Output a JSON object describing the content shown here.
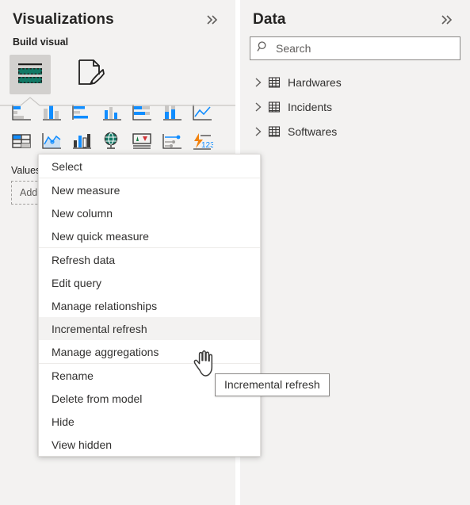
{
  "panes": {
    "visualizations": {
      "title": "Visualizations",
      "collapse_icon": "chevron-double-right-icon",
      "build_visual_label": "Build visual",
      "tabs": [
        {
          "name": "build-visual-tab",
          "icon": "fields-table-icon",
          "selected": true
        },
        {
          "name": "format-visual-tab",
          "icon": "paintbrush-page-icon",
          "selected": false
        }
      ],
      "gallery": [
        {
          "name": "stacked-bar-chart",
          "icon": "stacked-bar-chart-icon"
        },
        {
          "name": "stacked-column-chart",
          "icon": "stacked-column-chart-icon"
        },
        {
          "name": "clustered-bar-chart",
          "icon": "clustered-bar-chart-icon"
        },
        {
          "name": "clustered-column-chart",
          "icon": "clustered-column-chart-icon"
        },
        {
          "name": "hundred-percent-stacked-bar-chart",
          "icon": "pct-stacked-bar-icon"
        },
        {
          "name": "hundred-percent-stacked-column-chart",
          "icon": "pct-stacked-column-icon"
        },
        {
          "name": "line-chart",
          "icon": "line-chart-icon"
        },
        {
          "name": "table",
          "icon": "table-icon"
        },
        {
          "name": "line-and-stacked-column-chart",
          "icon": "line-stacked-column-icon"
        },
        {
          "name": "ribbon-chart",
          "icon": "ribbon-chart-icon"
        },
        {
          "name": "map",
          "icon": "globe-map-icon"
        },
        {
          "name": "kpi",
          "icon": "kpi-icon"
        },
        {
          "name": "decomposition-tree",
          "icon": "decomposition-tree-icon"
        },
        {
          "name": "key-influencers",
          "icon": "key-influencers-icon"
        }
      ],
      "wells": {
        "values_label": "Values",
        "drop_placeholder": "Add data fields here"
      }
    },
    "data": {
      "title": "Data",
      "collapse_icon": "chevron-double-right-icon",
      "search": {
        "icon": "search-icon",
        "placeholder": "Search",
        "value": ""
      },
      "tables": [
        {
          "label": "Hardwares",
          "icon": "table-icon",
          "chevron": "chevron-right-icon",
          "expanded": false
        },
        {
          "label": "Incidents",
          "icon": "table-icon",
          "chevron": "chevron-right-icon",
          "expanded": false
        },
        {
          "label": "Softwares",
          "icon": "table-icon",
          "chevron": "chevron-right-icon",
          "expanded": false
        }
      ]
    }
  },
  "context_menu": {
    "name": "table-context-menu",
    "items": [
      {
        "label": "Select",
        "separator_after": true,
        "hovered": false
      },
      {
        "label": "New measure",
        "separator_after": false,
        "hovered": false
      },
      {
        "label": "New column",
        "separator_after": false,
        "hovered": false
      },
      {
        "label": "New quick measure",
        "separator_after": true,
        "hovered": false
      },
      {
        "label": "Refresh data",
        "separator_after": false,
        "hovered": false
      },
      {
        "label": "Edit query",
        "separator_after": false,
        "hovered": false
      },
      {
        "label": "Manage relationships",
        "separator_after": false,
        "hovered": false
      },
      {
        "label": "Incremental refresh",
        "separator_after": false,
        "hovered": true
      },
      {
        "label": "Manage aggregations",
        "separator_after": true,
        "hovered": false
      },
      {
        "label": "Rename",
        "separator_after": false,
        "hovered": false
      },
      {
        "label": "Delete from model",
        "separator_after": false,
        "hovered": false
      },
      {
        "label": "Hide",
        "separator_after": false,
        "hovered": false
      },
      {
        "label": "View hidden",
        "separator_after": false,
        "hovered": false
      }
    ]
  },
  "tooltip": {
    "name": "incremental-refresh-tooltip",
    "text": "Incremental refresh"
  },
  "cursor": {
    "name": "hand-pointer-cursor"
  },
  "colors": {
    "pane_background": "#f3f2f1",
    "menu_background": "#ffffff",
    "menu_hover": "#f3f2f1",
    "text_primary": "#323130",
    "text_secondary": "#605e5c",
    "accent_teal": "#117865",
    "accent_blue": "#118dff",
    "border": "#8a8886"
  }
}
